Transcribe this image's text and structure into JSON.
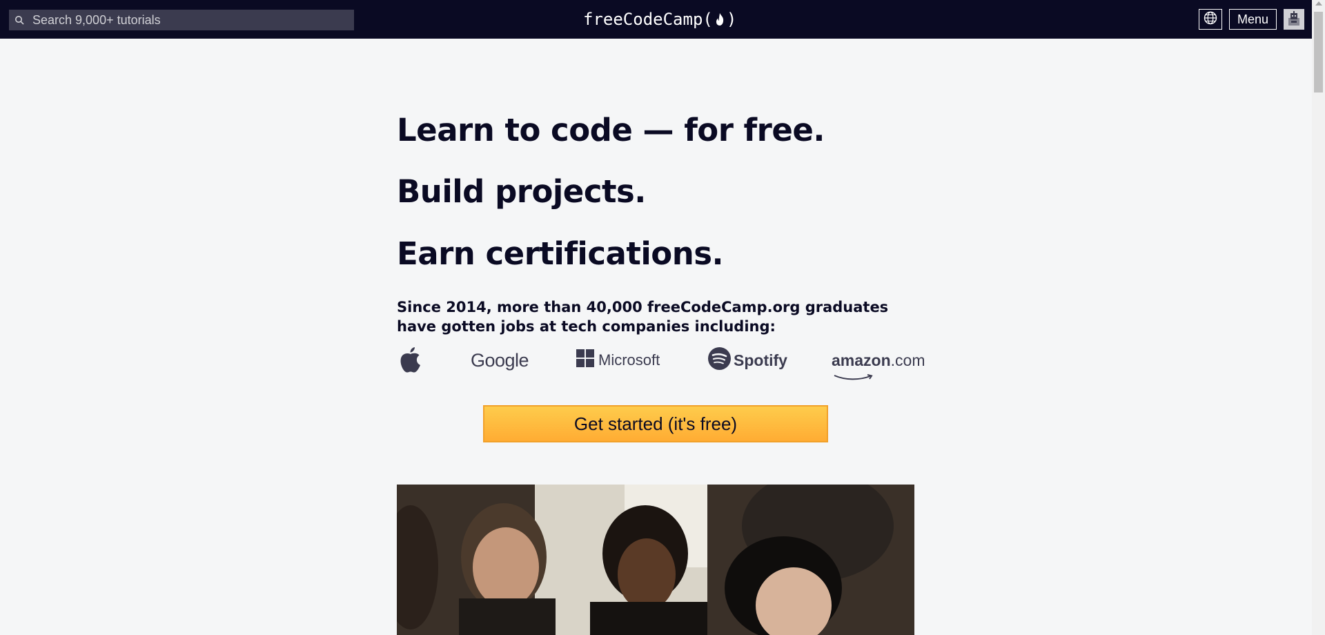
{
  "search": {
    "placeholder": "Search 9,000+ tutorials"
  },
  "logo": {
    "text_left": "freeCodeCamp(",
    "text_right": ")"
  },
  "nav": {
    "menu_label": "Menu"
  },
  "hero": {
    "line1": "Learn to code — for free.",
    "line2": "Build projects.",
    "line3": "Earn certifications.",
    "since": "Since 2014, more than 40,000 freeCodeCamp.org graduates have gotten jobs at tech companies including:"
  },
  "companies": {
    "google": "Google",
    "microsoft": "Microsoft",
    "spotify": "Spotify",
    "amazon_main": "amazon",
    "amazon_suffix": ".com"
  },
  "cta": {
    "label": "Get started (it's free)"
  },
  "colors": {
    "nav_bg": "#0a0a23",
    "page_bg": "#f5f6f7",
    "cta_gradient_top": "#fecc4c",
    "cta_gradient_bottom": "#ffac33",
    "text": "#0a0a23"
  },
  "icons": {
    "search": "search-icon",
    "language": "globe-icon",
    "avatar": "avatar-icon",
    "flame": "flame-icon"
  }
}
